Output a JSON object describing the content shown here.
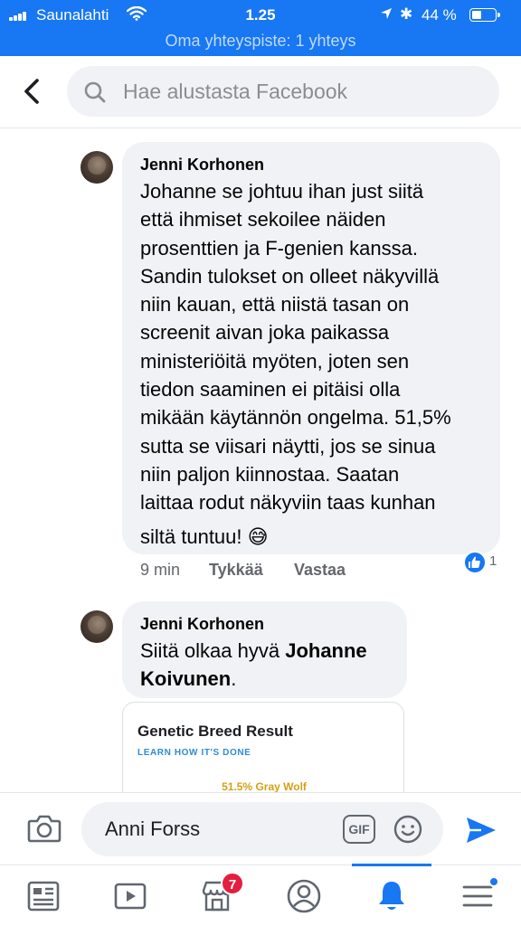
{
  "status_bar": {
    "carrier": "Saunalahti",
    "time": "1.25",
    "battery_percent": "44 %",
    "battery_level": 0.44,
    "hotspot": "Oma yhteyspiste: 1 yhteys"
  },
  "header": {
    "search_placeholder": "Hae alustasta Facebook"
  },
  "comments": [
    {
      "author": "Jenni Korhonen",
      "lines": [
        "Johanne se johtuu ihan just siitä",
        "että ihmiset sekoilee näiden",
        "prosenttien ja F-genien kanssa.",
        "Sandin tulokset on olleet näkyvillä",
        "niin kauan, että niistä tasan on",
        "screenit aivan joka paikassa",
        "ministeriöitä myöten, joten sen",
        "tiedon saaminen ei pitäisi olla",
        "mikään käytännön ongelma. 51,5%",
        "sutta se viisari näytti, jos se sinua",
        "niin paljon kiinnostaa. Saatan",
        "laittaa rodut näkyviin taas kunhan",
        "siltä tuntuu!"
      ],
      "emoji": "😅",
      "time": "9 min",
      "like_label": "Tykkää",
      "reply_label": "Vastaa",
      "reaction_count": "1"
    },
    {
      "author": "Jenni Korhonen",
      "text_plain": "Siitä olkaa hyvä ",
      "mention_line1": "Johanne",
      "mention_line2": "Koivunen",
      "text_tail": "."
    }
  ],
  "link_card": {
    "title": "Genetic Breed Result",
    "subtitle": "LEARN HOW IT'S DONE",
    "value": "51.5% Gray Wolf"
  },
  "composer": {
    "text": "Anni Forss",
    "gif_label": "GIF"
  },
  "tabbar": {
    "marketplace_badge": "7",
    "active_tab": "notifications"
  },
  "colors": {
    "brand": "#1877f2",
    "bubble": "#f0f2f5",
    "badge": "#e41e3f"
  }
}
